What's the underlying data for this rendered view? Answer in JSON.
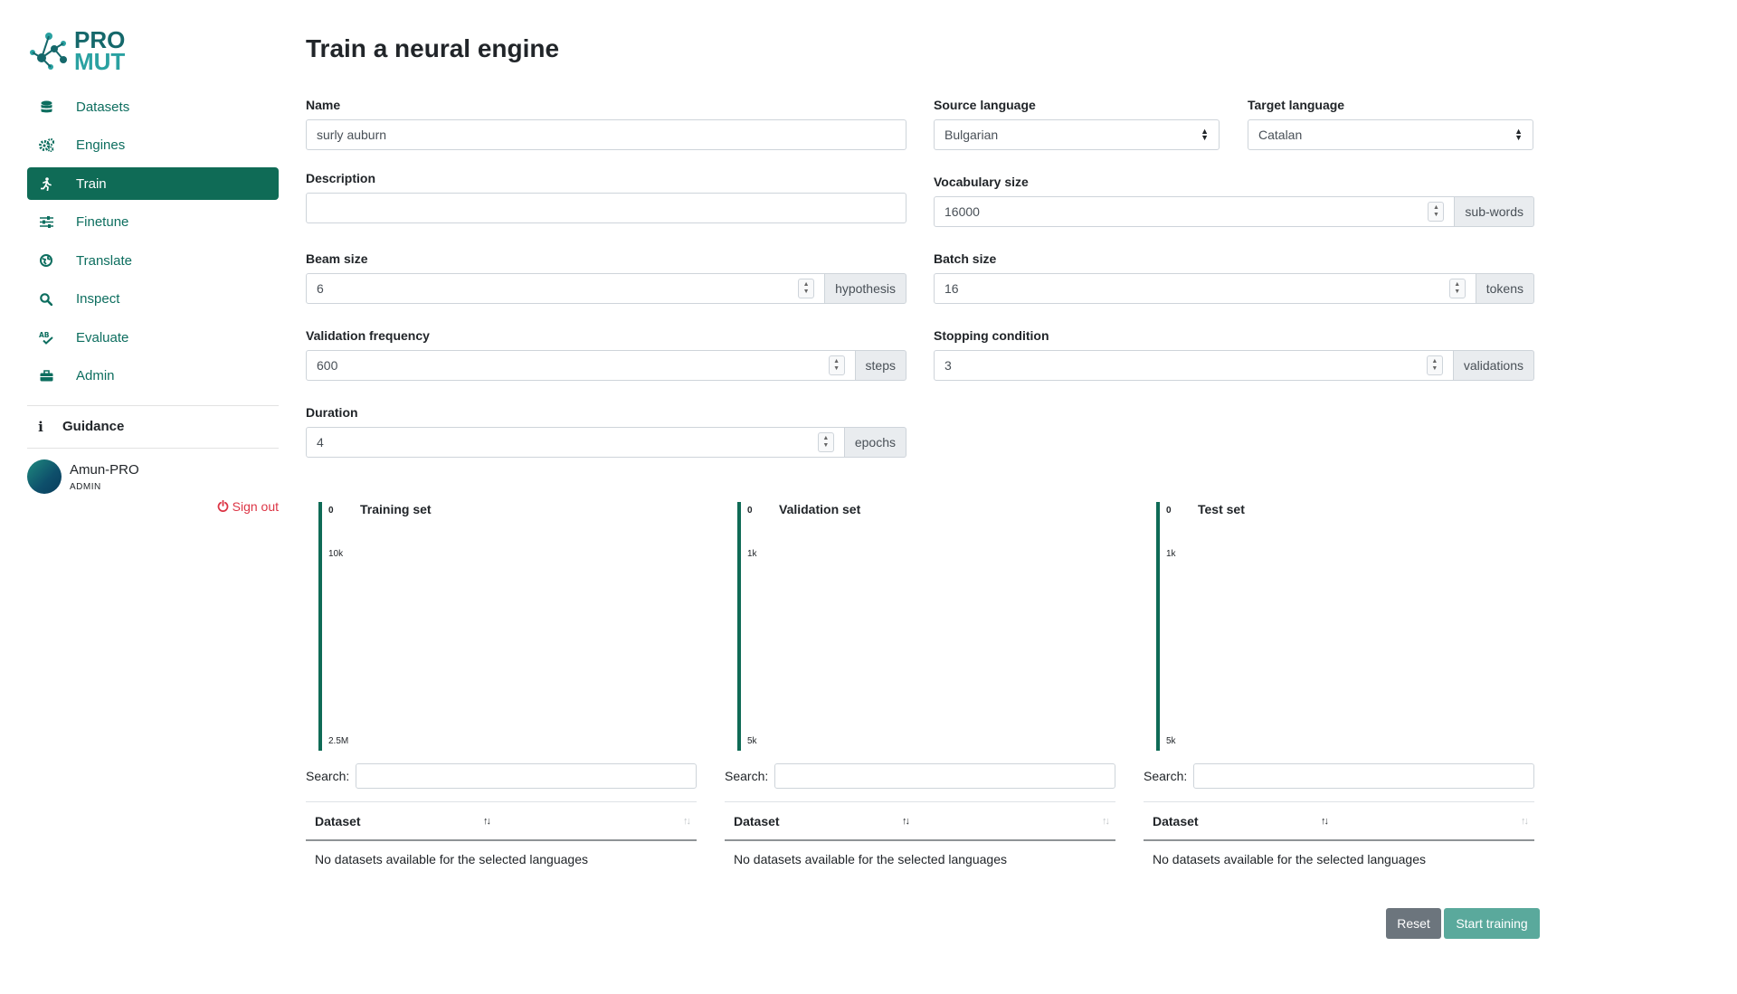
{
  "brand": {
    "line1": "PRO",
    "line2": "MUT"
  },
  "sidebar": {
    "items": [
      {
        "label": "Datasets",
        "icon": "database-icon"
      },
      {
        "label": "Engines",
        "icon": "gears-icon"
      },
      {
        "label": "Train",
        "icon": "running-icon",
        "active": true
      },
      {
        "label": "Finetune",
        "icon": "sliders-icon"
      },
      {
        "label": "Translate",
        "icon": "globe-icon"
      },
      {
        "label": "Inspect",
        "icon": "search-icon"
      },
      {
        "label": "Evaluate",
        "icon": "spell-check-icon"
      },
      {
        "label": "Admin",
        "icon": "toolbox-icon"
      }
    ],
    "guidance": "Guidance",
    "user": {
      "name": "Amun-PRO",
      "role": "ADMIN"
    },
    "signout": "Sign out"
  },
  "page": {
    "title": "Train a neural engine"
  },
  "form": {
    "name": {
      "label": "Name",
      "value": "surly auburn"
    },
    "description": {
      "label": "Description",
      "value": ""
    },
    "source_language": {
      "label": "Source language",
      "value": "Bulgarian"
    },
    "target_language": {
      "label": "Target language",
      "value": "Catalan"
    },
    "vocabulary_size": {
      "label": "Vocabulary size",
      "value": "16000",
      "unit": "sub-words"
    },
    "beam_size": {
      "label": "Beam size",
      "value": "6",
      "unit": "hypothesis"
    },
    "batch_size": {
      "label": "Batch size",
      "value": "16",
      "unit": "tokens"
    },
    "validation_frequency": {
      "label": "Validation frequency",
      "value": "600",
      "unit": "steps"
    },
    "stopping_condition": {
      "label": "Stopping condition",
      "value": "3",
      "unit": "validations"
    },
    "duration": {
      "label": "Duration",
      "value": "4",
      "unit": "epochs"
    }
  },
  "panels": [
    {
      "title": "Training set",
      "ticks": [
        "0",
        "10k",
        "2.5M"
      ]
    },
    {
      "title": "Validation set",
      "ticks": [
        "0",
        "1k",
        "5k"
      ]
    },
    {
      "title": "Test set",
      "ticks": [
        "0",
        "1k",
        "5k"
      ]
    }
  ],
  "table": {
    "search_label": "Search:",
    "column": "Dataset",
    "empty": "No datasets available for the selected languages"
  },
  "buttons": {
    "reset": "Reset",
    "start": "Start training"
  },
  "colors": {
    "accent": "#0f6b56",
    "danger": "#dc3545",
    "start_button": "#5aa99c",
    "reset_button": "#6c757d"
  }
}
